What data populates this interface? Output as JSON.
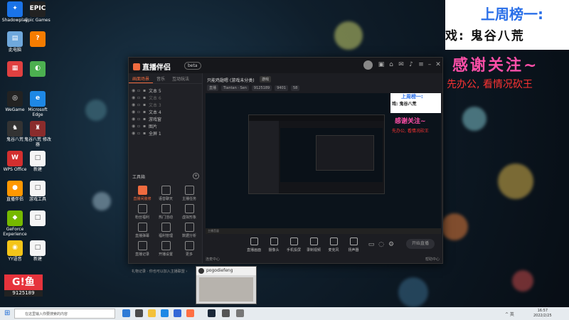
{
  "desktop": {
    "icons": [
      {
        "label": "Shadowplay",
        "color": "#1a73e8",
        "glyph": "✦"
      },
      {
        "label": "Epic Games",
        "color": "#222",
        "glyph": "EPIC"
      },
      {
        "label": "此电脑",
        "color": "#6fa8dc",
        "glyph": "▤"
      },
      {
        "label": "",
        "color": "#f57c00",
        "glyph": "?"
      },
      {
        "label": "",
        "color": "#e04040",
        "glyph": "▦"
      },
      {
        "label": "",
        "color": "#4caf50",
        "glyph": "◐"
      },
      {
        "label": "WeGame",
        "color": "#222",
        "glyph": "◎"
      },
      {
        "label": "Microsoft Edge",
        "color": "#1e88e5",
        "glyph": "e"
      },
      {
        "label": "鬼谷八荒",
        "color": "#333",
        "glyph": "♞"
      },
      {
        "label": "鬼谷八荒 修改器",
        "color": "#8a2c2c",
        "glyph": "♜"
      },
      {
        "label": "WPS Office",
        "color": "#d32f2f",
        "glyph": "W"
      },
      {
        "label": "新建",
        "color": "#f5f5f5",
        "glyph": "□"
      },
      {
        "label": "直播伴侣",
        "color": "#ff9800",
        "glyph": "●"
      },
      {
        "label": "游戏工具",
        "color": "#f5f5f5",
        "glyph": "□"
      },
      {
        "label": "GeForce Experience",
        "color": "#76b900",
        "glyph": "◆"
      },
      {
        "label": "",
        "color": "#f5f5f5",
        "glyph": "□"
      },
      {
        "label": "YY语音",
        "color": "#f5c518",
        "glyph": "◉"
      },
      {
        "label": "新建",
        "color": "#f5f5f5",
        "glyph": "□"
      }
    ],
    "live_badge_text": "G!鱼",
    "live_badge_number": "9125189"
  },
  "overlay": {
    "rank_title": "上周榜一:",
    "rank_name": "戏: 鬼谷八荒",
    "thanks": "感谢关注~",
    "tip": "先办公, 看情况砍王"
  },
  "app": {
    "name": "直播伴侣",
    "version": "beta",
    "left_tabs": [
      "画面场景",
      "音乐",
      "互动玩法"
    ],
    "sources": [
      {
        "name": "文本 5",
        "dim": false
      },
      {
        "name": "文本 6",
        "dim": true
      },
      {
        "name": "文本 3",
        "dim": true
      },
      {
        "name": "文本 4",
        "dim": false
      },
      {
        "name": "游戏窗",
        "dim": false
      },
      {
        "name": "图片",
        "dim": false
      },
      {
        "name": "全屏 1",
        "dim": false
      }
    ],
    "tools_header": "工具箱",
    "tools": [
      {
        "label": "直播间装修",
        "accent": true
      },
      {
        "label": "语音聊天",
        "accent": false
      },
      {
        "label": "主播任务",
        "accent": false
      },
      {
        "label": "粉丝福利",
        "accent": false
      },
      {
        "label": "热门活动",
        "accent": false
      },
      {
        "label": "虚拟形象",
        "accent": false
      },
      {
        "label": "直播弹幕",
        "accent": false
      },
      {
        "label": "福利管理",
        "accent": false
      },
      {
        "label": "数据分析",
        "accent": false
      },
      {
        "label": "直播记录",
        "accent": false
      },
      {
        "label": "开播设置",
        "accent": false
      },
      {
        "label": "更多",
        "accent": false
      }
    ],
    "left_footer": "礼物记录 · 你也可以加入主播联盟 ›",
    "room_title": "只能鸡翅嗯 (游戏未分类)",
    "room_badge": "游戏",
    "room_info": [
      "直播",
      "Tiantan · Sen",
      "9125189",
      "9401",
      "58"
    ],
    "preview_bar": "主播音量",
    "mini_overlay": {
      "a": "上周榜一:",
      "b": "戏: 鬼谷八荒",
      "thanks": "感谢关注~",
      "tip": "先办公, 看情况砍王"
    },
    "controls": [
      {
        "label": "直播画面"
      },
      {
        "label": "摄像头"
      },
      {
        "label": "手机投屏"
      },
      {
        "label": "录制视频"
      },
      {
        "label": "麦克风"
      },
      {
        "label": "扬声器"
      }
    ],
    "start_button": "开始直播",
    "right_footer_left": "连麦中心",
    "right_footer_right": "帮助中心"
  },
  "mini_window": {
    "title": "pogodiefeng"
  },
  "taskbar": {
    "search_placeholder": "在这里输入你要搜索的内容",
    "time": "16:57",
    "date": "2022/2/25",
    "tray": "^ 英"
  }
}
